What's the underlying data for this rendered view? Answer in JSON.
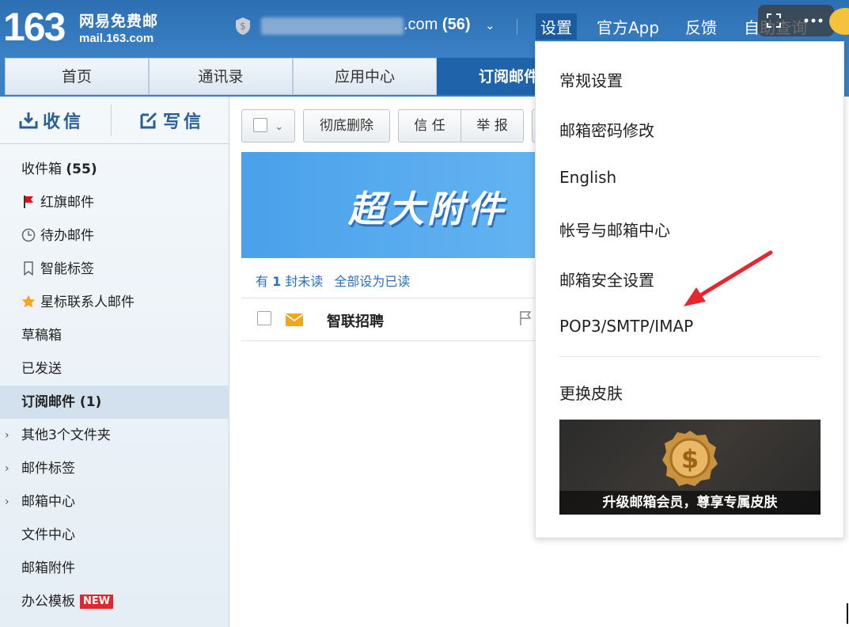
{
  "logo": {
    "number": "163",
    "cn": "网易免费邮",
    "en": "mail.163.com"
  },
  "account": {
    "domain": ".com",
    "count": "(56)",
    "caret": "⌄"
  },
  "top_links": {
    "settings": "设置",
    "app": "官方App",
    "feedback": "反馈",
    "self_query": "自助查询"
  },
  "tabs": [
    "首页",
    "通讯录",
    "应用中心",
    "订阅邮件"
  ],
  "sidebar": {
    "receive": "收信",
    "compose": "写信",
    "folders": [
      {
        "label": "收件箱 ",
        "count": "(55)"
      },
      {
        "label": "红旗邮件"
      },
      {
        "label": "待办邮件"
      },
      {
        "label": "智能标签"
      },
      {
        "label": "星标联系人邮件"
      },
      {
        "label": "草稿箱"
      },
      {
        "label": "已发送"
      },
      {
        "label": "订阅邮件 (1)"
      },
      {
        "label": "其他3个文件夹"
      },
      {
        "label": "邮件标签"
      },
      {
        "label": "邮箱中心"
      },
      {
        "label": "文件中心"
      },
      {
        "label": "邮箱附件"
      },
      {
        "label": "办公模板",
        "badge": "NEW"
      }
    ]
  },
  "toolbar": {
    "delete": "彻底删除",
    "trust": "信 任",
    "report": "举 报",
    "select_caret": "⌄"
  },
  "banner": {
    "text": "超大附件"
  },
  "unread": {
    "prefix": "有 ",
    "count": "1",
    "suffix": " 封未读",
    "mark_all": "全部设为已读"
  },
  "mail_list": [
    {
      "from": "智联招聘"
    }
  ],
  "settings_menu": {
    "items": [
      "常规设置",
      "邮箱密码修改",
      "English",
      "帐号与邮箱中心",
      "邮箱安全设置",
      "POP3/SMTP/IMAP",
      "更换皮肤"
    ],
    "skin_caption": "升级邮箱会员，尊享专属皮肤"
  },
  "colors": {
    "header": "#3a80c4",
    "active_tab": "#1f64ab",
    "link": "#2a6fbf",
    "flag": "#d9141b",
    "star": "#f5a623",
    "arrow": "#e8262e"
  }
}
